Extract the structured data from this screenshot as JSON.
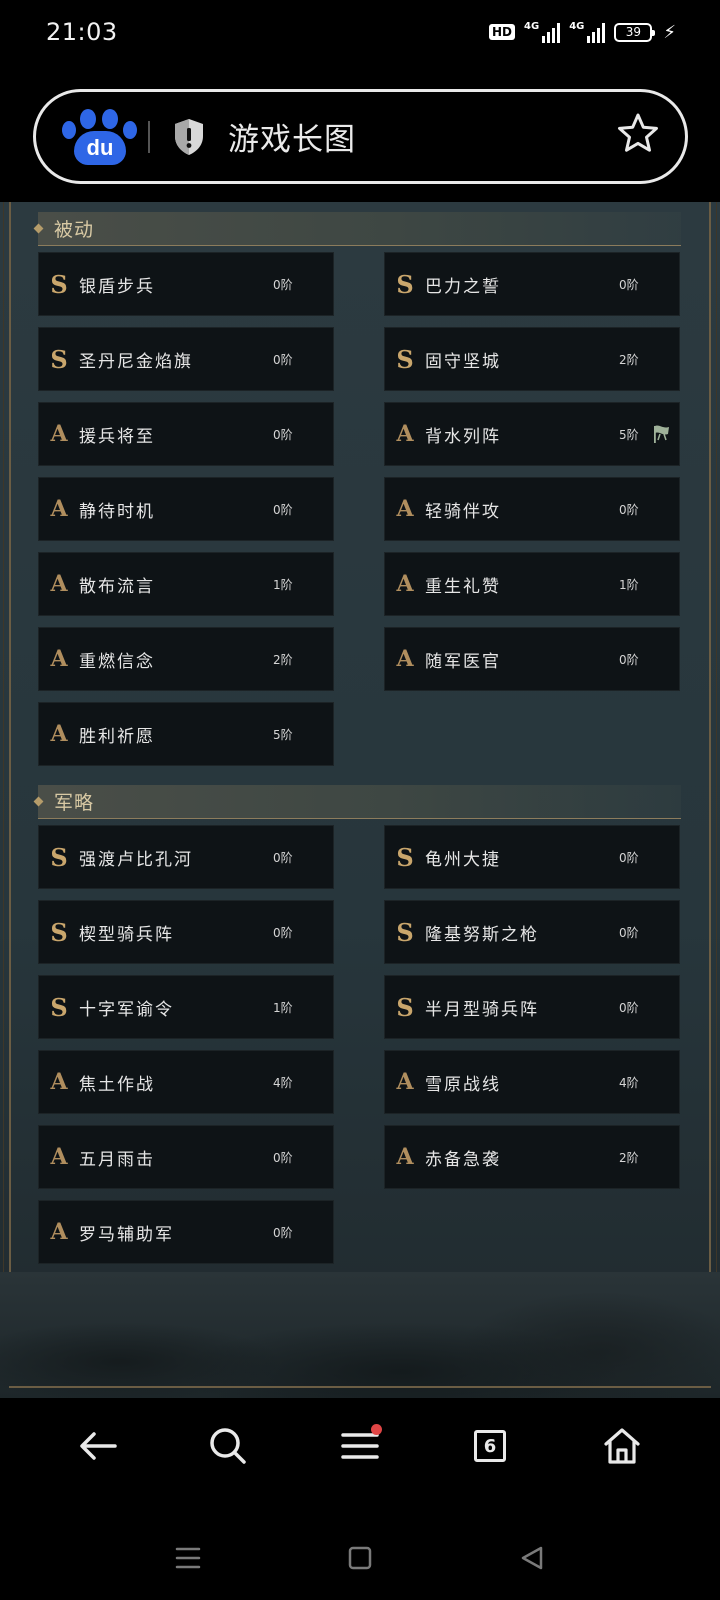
{
  "status": {
    "time": "21:03",
    "hd": "HD",
    "net1": "4G",
    "net2": "4G",
    "battery": "39"
  },
  "url_bar": {
    "title": "游戏长图",
    "logo_text": "du"
  },
  "sections": [
    {
      "title": "被动",
      "cards": [
        {
          "grade": "S",
          "name": "银盾步兵",
          "tier": "0阶"
        },
        {
          "grade": "S",
          "name": "巴力之誓",
          "tier": "0阶"
        },
        {
          "grade": "S",
          "name": "圣丹尼金焰旗",
          "tier": "0阶"
        },
        {
          "grade": "S",
          "name": "固守坚城",
          "tier": "2阶"
        },
        {
          "grade": "A",
          "name": "援兵将至",
          "tier": "0阶"
        },
        {
          "grade": "A",
          "name": "背水列阵",
          "tier": "5阶"
        },
        {
          "grade": "A",
          "name": "静待时机",
          "tier": "0阶"
        },
        {
          "grade": "A",
          "name": "轻骑伴攻",
          "tier": "0阶"
        },
        {
          "grade": "A",
          "name": "散布流言",
          "tier": "1阶"
        },
        {
          "grade": "A",
          "name": "重生礼赞",
          "tier": "1阶"
        },
        {
          "grade": "A",
          "name": "重燃信念",
          "tier": "2阶"
        },
        {
          "grade": "A",
          "name": "随军医官",
          "tier": "0阶"
        },
        {
          "grade": "A",
          "name": "胜利祈愿",
          "tier": "5阶"
        }
      ]
    },
    {
      "title": "军略",
      "cards": [
        {
          "grade": "S",
          "name": "强渡卢比孔河",
          "tier": "0阶"
        },
        {
          "grade": "S",
          "name": "龟州大捷",
          "tier": "0阶"
        },
        {
          "grade": "S",
          "name": "楔型骑兵阵",
          "tier": "0阶"
        },
        {
          "grade": "S",
          "name": "隆基努斯之枪",
          "tier": "0阶"
        },
        {
          "grade": "S",
          "name": "十字军谕令",
          "tier": "1阶"
        },
        {
          "grade": "S",
          "name": "半月型骑兵阵",
          "tier": "0阶"
        },
        {
          "grade": "A",
          "name": "焦土作战",
          "tier": "4阶"
        },
        {
          "grade": "A",
          "name": "雪原战线",
          "tier": "4阶"
        },
        {
          "grade": "A",
          "name": "五月雨击",
          "tier": "0阶"
        },
        {
          "grade": "A",
          "name": "赤备急袭",
          "tier": "2阶"
        },
        {
          "grade": "A",
          "name": "罗马辅助军",
          "tier": "0阶"
        }
      ]
    }
  ],
  "toolbar": {
    "tabs_count": "6"
  },
  "colors": {
    "grade_s": "#c9a66c",
    "grade_a": "#b08e5e",
    "section_title": "#d8c9a4",
    "card_bg": "#0e1316",
    "notification_dot": "#e04646",
    "baidu_blue": "#2e66e6"
  },
  "icons": {
    "back": "arrow-left-icon",
    "search": "search-icon",
    "menu": "hamburger-menu-icon",
    "tabs": "tabs-icon",
    "home": "home-icon",
    "favorite": "star-icon",
    "security": "shield-alert-icon",
    "flag": "flag-icon"
  }
}
